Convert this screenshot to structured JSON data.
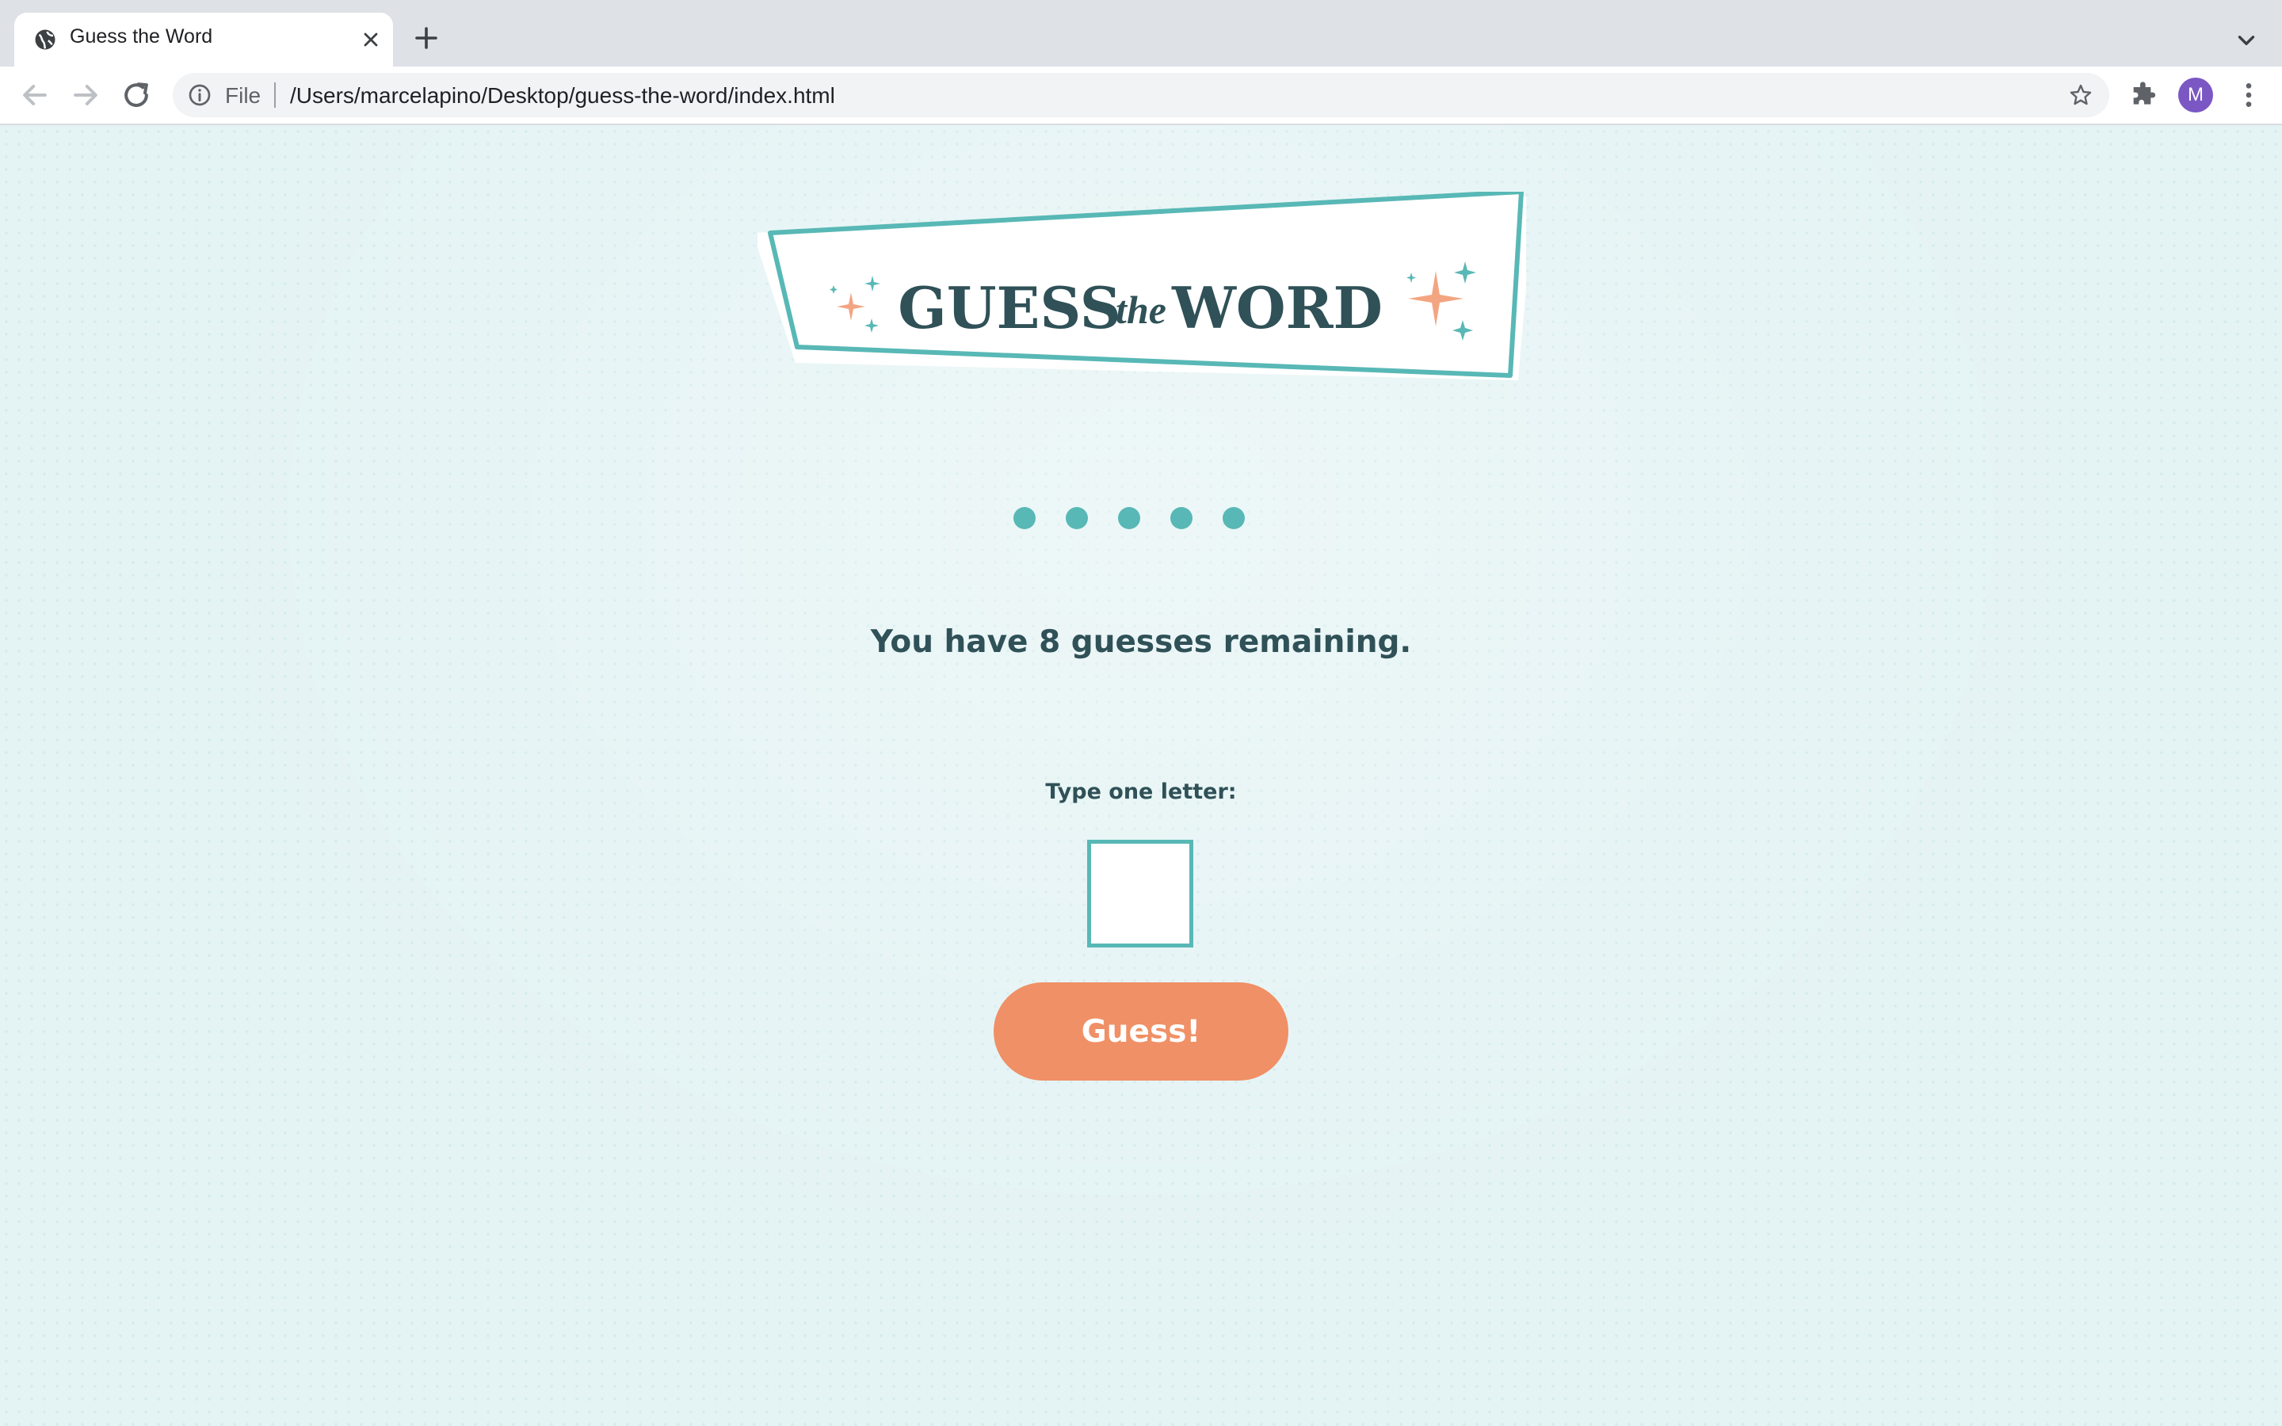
{
  "browser": {
    "tab": {
      "title": "Guess the Word"
    },
    "address": {
      "scheme_label": "File",
      "url": "/Users/marcelapino/Desktop/guess-the-word/index.html"
    },
    "profile": {
      "initial": "M",
      "color": "#7b57c4"
    },
    "icons": {
      "favicon": "globe-icon",
      "close": "close-icon",
      "new_tab": "plus-icon",
      "tab_search": "chevron-down-icon",
      "back": "arrow-left-icon",
      "forward": "arrow-right-icon",
      "reload": "reload-icon",
      "site_info": "info-icon",
      "bookmark": "star-icon",
      "extensions": "puzzle-icon",
      "menu": "kebab-menu-icon"
    }
  },
  "page": {
    "logo": {
      "word1": "GUESS",
      "word2": "the",
      "word3": "WORD"
    },
    "word_in_progress": [
      "●",
      "●",
      "●",
      "●",
      "●"
    ],
    "remaining_text": "You have 8 guesses remaining.",
    "input_label": "Type one letter:",
    "letter_input_value": "",
    "guess_button_label": "Guess!"
  },
  "colors": {
    "page_background": "#e4f3f4",
    "teal_accent": "#58b8b6",
    "dark_text": "#2f5157",
    "button_orange": "#f09066",
    "sparkle_peach": "#f3a582"
  }
}
